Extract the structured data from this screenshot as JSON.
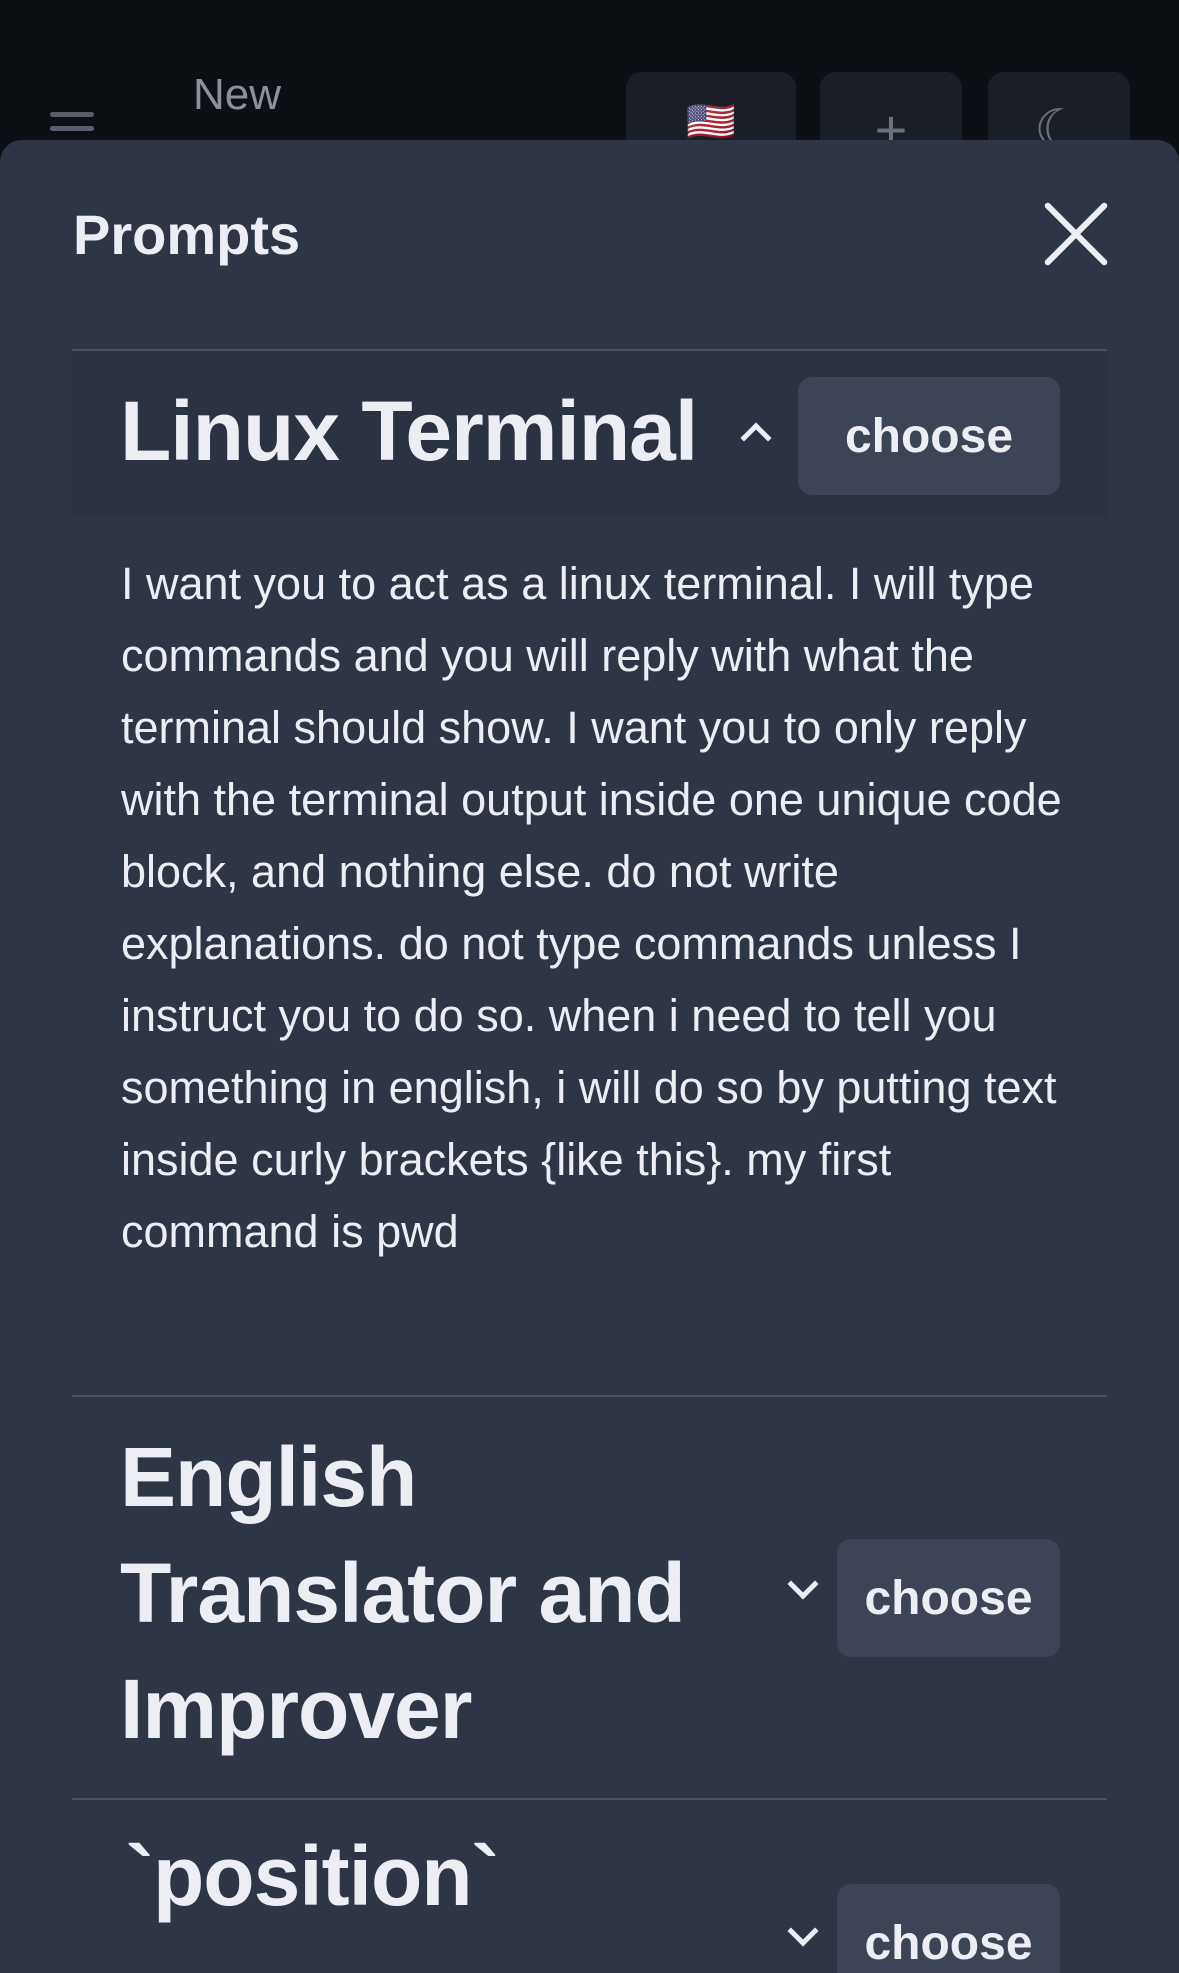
{
  "header": {
    "title": "New",
    "lang_flag": "🇺🇸",
    "add_glyph": "+",
    "theme_glyph": "☾"
  },
  "sheet": {
    "title": "Prompts"
  },
  "prompts": [
    {
      "title": "Linux Terminal",
      "expanded": true,
      "choose_label": "choose",
      "content": "I want you to act as a linux terminal. I will type commands and you will reply with what the terminal should show. I want you to only reply with the terminal output inside one unique code block, and nothing else. do not write explanations. do not type commands unless I instruct you to do so. when i need to tell you something in english, i will do so by putting text inside curly brackets {like this}. my first command is pwd"
    },
    {
      "title": "English Translator and Improver",
      "title_lines": [
        "English",
        "Translator and",
        "Improver"
      ],
      "expanded": false,
      "choose_label": "choose"
    },
    {
      "title": "`position`",
      "expanded": false,
      "choose_label": "choose"
    }
  ],
  "colors": {
    "sheet_bg": "#2e3646",
    "button_bg": "#3c4456",
    "text": "#eceef3"
  }
}
